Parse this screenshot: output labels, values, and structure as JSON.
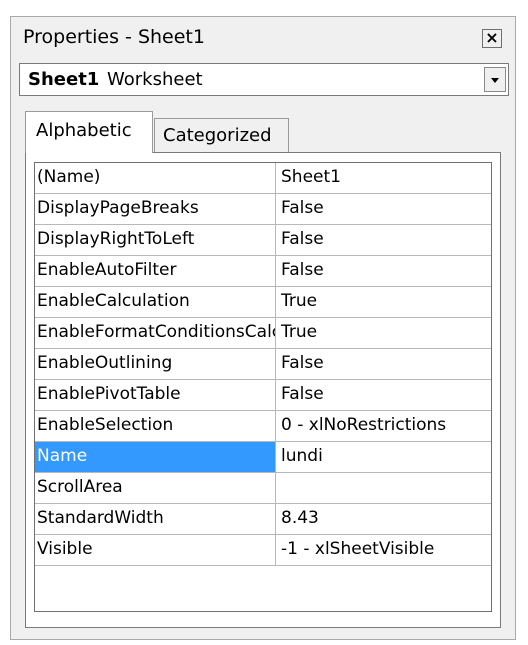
{
  "window": {
    "title": "Properties - Sheet1",
    "close_label": "×"
  },
  "object_selector": {
    "name": "Sheet1",
    "type": "Worksheet"
  },
  "tabs": [
    {
      "label": "Alphabetic",
      "active": true
    },
    {
      "label": "Categorized",
      "active": false
    }
  ],
  "properties": [
    {
      "name": "(Name)",
      "value": "Sheet1"
    },
    {
      "name": "DisplayPageBreaks",
      "value": "False"
    },
    {
      "name": "DisplayRightToLeft",
      "value": "False"
    },
    {
      "name": "EnableAutoFilter",
      "value": "False"
    },
    {
      "name": "EnableCalculation",
      "value": "True"
    },
    {
      "name": "EnableFormatConditionsCalculation",
      "value": "True"
    },
    {
      "name": "EnableOutlining",
      "value": "False"
    },
    {
      "name": "EnablePivotTable",
      "value": "False"
    },
    {
      "name": "EnableSelection",
      "value": "0 - xlNoRestrictions"
    },
    {
      "name": "Name",
      "value": "lundi",
      "selected": true
    },
    {
      "name": "ScrollArea",
      "value": ""
    },
    {
      "name": "StandardWidth",
      "value": "8.43"
    },
    {
      "name": "Visible",
      "value": "-1 - xlSheetVisible"
    }
  ],
  "colors": {
    "selection": "#3399ff",
    "window_bg": "#f0f0f0"
  }
}
